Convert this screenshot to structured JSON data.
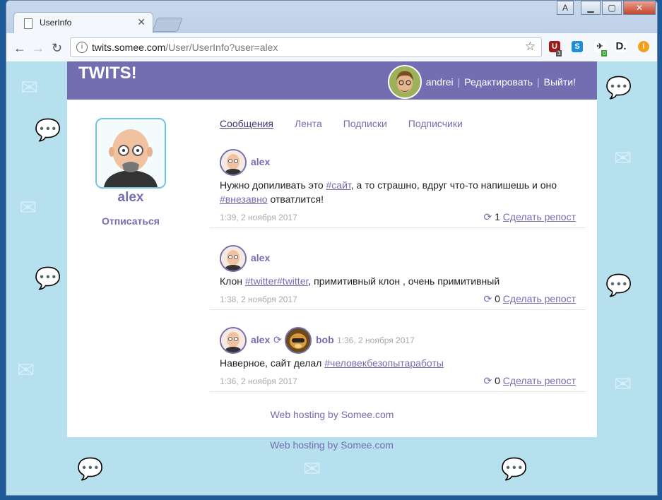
{
  "browser": {
    "tab_title": "UserInfo",
    "url_host": "twits.somee.com",
    "url_path": "/User/UserInfo?user=alex",
    "win_profile": "A",
    "ext_badge_ublock": "3",
    "ext_badge_other": "0"
  },
  "site": {
    "brand": "TWITS!",
    "current_user": "andrei",
    "edit_label": "Редактировать",
    "logout_label": "Выйти!",
    "footer": "Web hosting by Somee.com"
  },
  "profile": {
    "name": "alex",
    "unfollow_label": "Отписаться"
  },
  "tabs": [
    {
      "label": "Сообщения",
      "active": true
    },
    {
      "label": "Лента",
      "active": false
    },
    {
      "label": "Подписки",
      "active": false
    },
    {
      "label": "Подписчики",
      "active": false
    }
  ],
  "posts": [
    {
      "author": "alex",
      "text_1": "Нужно допиливать это ",
      "tag_1": "#сайт",
      "text_2": ", а то страшно, вдруг что-то напишешь и оно ",
      "tag_2": "#внезавно",
      "text_3": " отватлится!",
      "time": "1:39, 2 ноября 2017",
      "repost_count": "1",
      "repost_label": "Сделать репост"
    },
    {
      "author": "alex",
      "text_1": "Клон ",
      "tag_1": "#twitter#twitter",
      "text_2": ", примитивный клон , очень примитивный",
      "time": "1:38, 2 ноября 2017",
      "repost_count": "0",
      "repost_label": "Сделать репост"
    },
    {
      "author": "alex",
      "original_author": "bob",
      "original_time": "1:36, 2 ноября 2017",
      "text_1": "Наверное, сайт делал ",
      "tag_1": "#человекбезопытаработы",
      "time": "1:36, 2 ноября 2017",
      "repost_count": "0",
      "repost_label": "Сделать репост"
    }
  ],
  "page_footer": "Web hosting by Somee.com",
  "colors": {
    "accent": "#736eb1",
    "background": "#b6e0ee",
    "profile_border": "#6ec6dc"
  }
}
